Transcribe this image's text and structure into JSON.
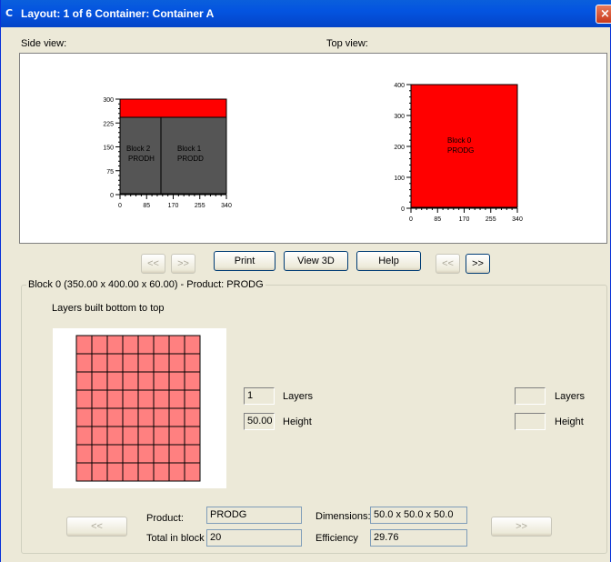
{
  "window": {
    "title": "Layout: 1 of 6  Container: Container A",
    "title_icon": "C",
    "close_label": "×",
    "accent": "#0454e0"
  },
  "views": {
    "side_label": "Side view:",
    "top_label": "Top view:",
    "side_view": {
      "y_ticks": [
        "300",
        "225",
        "150",
        "75",
        "0"
      ],
      "x_ticks": [
        "0",
        "85",
        "170",
        "255",
        "340"
      ],
      "blocks": [
        {
          "name": "Block 2",
          "product": "PRODH"
        },
        {
          "name": "Block 1",
          "product": "PRODD"
        }
      ],
      "top_block_color": "#ff0000",
      "block_color": "#555555"
    },
    "top_view": {
      "y_ticks": [
        "400",
        "300",
        "200",
        "100",
        "0"
      ],
      "x_ticks": [
        "0",
        "85",
        "170",
        "255",
        "340"
      ],
      "block": {
        "name": "Block 0",
        "product": "PRODG"
      },
      "block_color": "#ff0000"
    }
  },
  "toolbar": {
    "prev_left": "<<",
    "next_left": ">>",
    "print": "Print",
    "view3d": "View 3D",
    "help": "Help",
    "prev_right": "<<",
    "next_right": ">>"
  },
  "block_group": {
    "title": "Block 0 (350.00 x 400.00 x 60.00) - Product: PRODG",
    "layers_note": "Layers built bottom to top",
    "grid": {
      "rows": 8,
      "cols": 8,
      "cell_color": "#ff8080"
    },
    "left_layers_value": "1",
    "left_layers_label": "Layers",
    "left_height_value": "50.00",
    "left_height_label": "Height",
    "right_layers_value": "",
    "right_layers_label": "Layers",
    "right_height_value": "",
    "right_height_label": "Height"
  },
  "bottom": {
    "prev_label": "<<",
    "next_label": ">>",
    "product_label": "Product:",
    "product_value": "PRODG",
    "total_label": "Total in block",
    "total_value": "20",
    "dimensions_label": "Dimensions:",
    "dimensions_value": "50.0 x 50.0 x 50.0",
    "efficiency_label": "Efficiency",
    "efficiency_value": "29.76"
  }
}
